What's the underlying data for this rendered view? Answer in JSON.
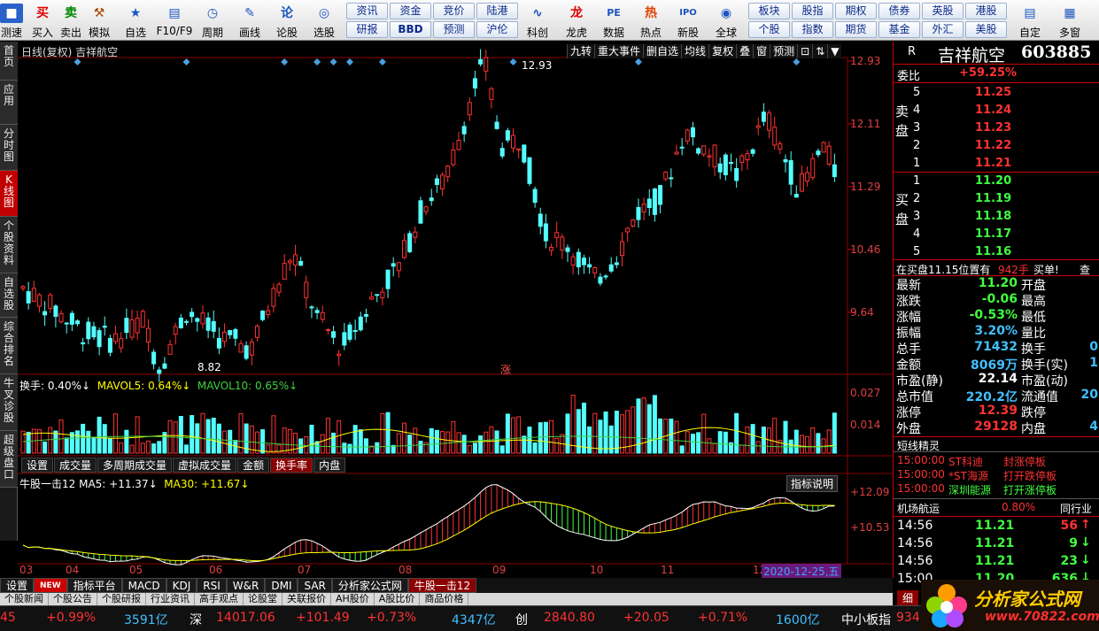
{
  "toolbar": {
    "buttons": [
      {
        "label": "测速",
        "icon": "■"
      },
      {
        "label": "买入",
        "icon": "买"
      },
      {
        "label": "卖出",
        "icon": "卖"
      },
      {
        "label": "模拟",
        "icon": "⚒"
      },
      {
        "label": "自选",
        "icon": "★"
      },
      {
        "label": "F10/F9",
        "icon": "▤"
      },
      {
        "label": "周期",
        "icon": "◷"
      },
      {
        "label": "画线",
        "icon": "✎"
      },
      {
        "label": "论股",
        "icon": "论"
      },
      {
        "label": "选股",
        "icon": "◎"
      }
    ],
    "grid": [
      [
        "资讯",
        "资金",
        "竞价",
        "陆港"
      ],
      [
        "研报",
        "BBD",
        "预测",
        "沪伦"
      ]
    ],
    "buttons2": [
      {
        "label": "科创",
        "icon": "∿"
      },
      {
        "label": "龙虎",
        "icon": "龙"
      },
      {
        "label": "数据",
        "icon": "PE"
      },
      {
        "label": "热点",
        "icon": "热"
      },
      {
        "label": "新股",
        "icon": "IPO"
      },
      {
        "label": "全球",
        "icon": "◉"
      }
    ],
    "grid2": [
      [
        "板块",
        "股指",
        "期权",
        "债券",
        "英股",
        "港股"
      ],
      [
        "个股",
        "指数",
        "期货",
        "基金",
        "外汇",
        "美股"
      ]
    ],
    "buttons3": [
      {
        "label": "自定",
        "icon": "▤"
      },
      {
        "label": "多窗",
        "icon": "▦"
      }
    ]
  },
  "left_tabs": [
    "首页",
    "应用",
    "分时图",
    "K线图",
    "个股资料",
    "自选股",
    "综合排名",
    "牛叉诊股",
    "超级盘口"
  ],
  "chart": {
    "title": "日线(复权)  吉祥航空",
    "controls": [
      "九转",
      "重大事件",
      "删自选",
      "均线",
      "复权",
      "叠",
      "窗",
      "预测",
      "⊡",
      "⇅",
      "▼"
    ],
    "y_labels": [
      "12.93",
      "12.11",
      "11.29",
      "10.46",
      "9.64"
    ],
    "high_label": "12.93",
    "low_label": "8.82",
    "zhang_label": "涨",
    "volume_header": {
      "label": "换手: 0.40%↓",
      "ma5": "MAVOL5: 0.64%↓",
      "ma10": "MAVOL10: 0.65%↓"
    },
    "volume_y": [
      "0.027",
      "0.014"
    ],
    "sub_tabs": [
      "设置",
      "成交量",
      "多周期成交量",
      "虚拟成交量",
      "金额",
      "换手率",
      "内盘"
    ],
    "active_sub_tab": "换手率",
    "indicator_header": {
      "label": "牛股一击12",
      "ma5": "MA5: +11.37↓",
      "ma30": "MA30: +11.67↓"
    },
    "indicator_button": "指标说明",
    "indicator_y": [
      "+12.09",
      "+10.53"
    ],
    "x_labels": [
      "03",
      "04",
      "05",
      "06",
      "07",
      "08",
      "09",
      "10",
      "11",
      "12"
    ],
    "date_label": "2020-12-25,五",
    "bottom_tabs": [
      "设置",
      "NEW",
      "指标平台",
      "MACD",
      "KDJ",
      "RSI",
      "W&R",
      "DMI",
      "SAR",
      "分析家公式网",
      "牛股一击12"
    ],
    "active_bottom_tab": "牛股一击12",
    "news_tabs": [
      "个股新闻",
      "个股公告",
      "个股研报",
      "行业资讯",
      "高手观点",
      "论股堂",
      "关联报价",
      "AH股价",
      "A股比价",
      "商品价格"
    ]
  },
  "quote": {
    "name": "吉祥航空",
    "code": "603885",
    "wb_label": "委比",
    "wb": "+59.25%",
    "sell": [
      [
        "5",
        "11.25"
      ],
      [
        "4",
        "11.24"
      ],
      [
        "3",
        "11.23"
      ],
      [
        "2",
        "11.22"
      ],
      [
        "1",
        "11.21"
      ]
    ],
    "buy": [
      [
        "1",
        "11.20"
      ],
      [
        "2",
        "11.19"
      ],
      [
        "3",
        "11.18"
      ],
      [
        "4",
        "11.17"
      ],
      [
        "5",
        "11.16"
      ]
    ],
    "sell_label": "卖盘",
    "buy_label": "买盘",
    "note": "在买盘11.15位置有",
    "note_vol": "942手",
    "note_tail": "买单!",
    "note_btn": "查",
    "stats": [
      [
        "最新",
        "11.20",
        "开盘",
        ""
      ],
      [
        "涨跌",
        "-0.06",
        "最高",
        ""
      ],
      [
        "涨幅",
        "-0.53%",
        "最低",
        ""
      ],
      [
        "振幅",
        "3.20%",
        "量比",
        ""
      ],
      [
        "总手",
        "71432",
        "换手",
        "0"
      ],
      [
        "金额",
        "8069万",
        "换手(实)",
        "1"
      ],
      [
        "市盈(静)",
        "22.14",
        "市盈(动)",
        ""
      ],
      [
        "总市值",
        "220.2亿",
        "流通值",
        "20"
      ],
      [
        "涨停",
        "12.39",
        "跌停",
        ""
      ],
      [
        "外盘",
        "29128",
        "内盘",
        "4"
      ]
    ],
    "short_title": "短线精灵",
    "short": [
      [
        "15:00:00",
        "ST科迪",
        "封涨停板"
      ],
      [
        "15:00:00",
        "*ST海源",
        "打开跌停板"
      ],
      [
        "15:00:00",
        "深圳能源",
        "打开涨停板"
      ]
    ],
    "industry": "机场航运",
    "industry_pct": "0.80%",
    "industry_btn": "同行业",
    "ticks": [
      [
        "14:56",
        "11.21",
        "56",
        "↑"
      ],
      [
        "14:56",
        "11.21",
        "9",
        "↓"
      ],
      [
        "14:56",
        "11.21",
        "23",
        "↓"
      ],
      [
        "15:00",
        "11.20",
        "636",
        "↓"
      ]
    ],
    "R": "R",
    "xi": "细"
  },
  "status": {
    "a_val": "45",
    "a_pct": "+0.99%",
    "a_amt": "3591亿",
    "sz_name": "深",
    "sz_val": "14017.06",
    "sz_chg": "+101.49",
    "sz_pct": "+0.73%",
    "sz_amt": "4347亿",
    "cy_name": "创",
    "cy_val": "2840.80",
    "cy_chg": "+20.05",
    "cy_pct": "+0.71%",
    "cy_amt": "1600亿",
    "zx": "中小板指",
    "zx_val": "934"
  },
  "logo": {
    "text": "分析家公式网",
    "url": "www.70822.com"
  },
  "colors": {
    "up": "#ff3232",
    "down": "#54ffff",
    "bg": "#000000",
    "yellow": "#ffff00",
    "grid": "#8b0000"
  }
}
